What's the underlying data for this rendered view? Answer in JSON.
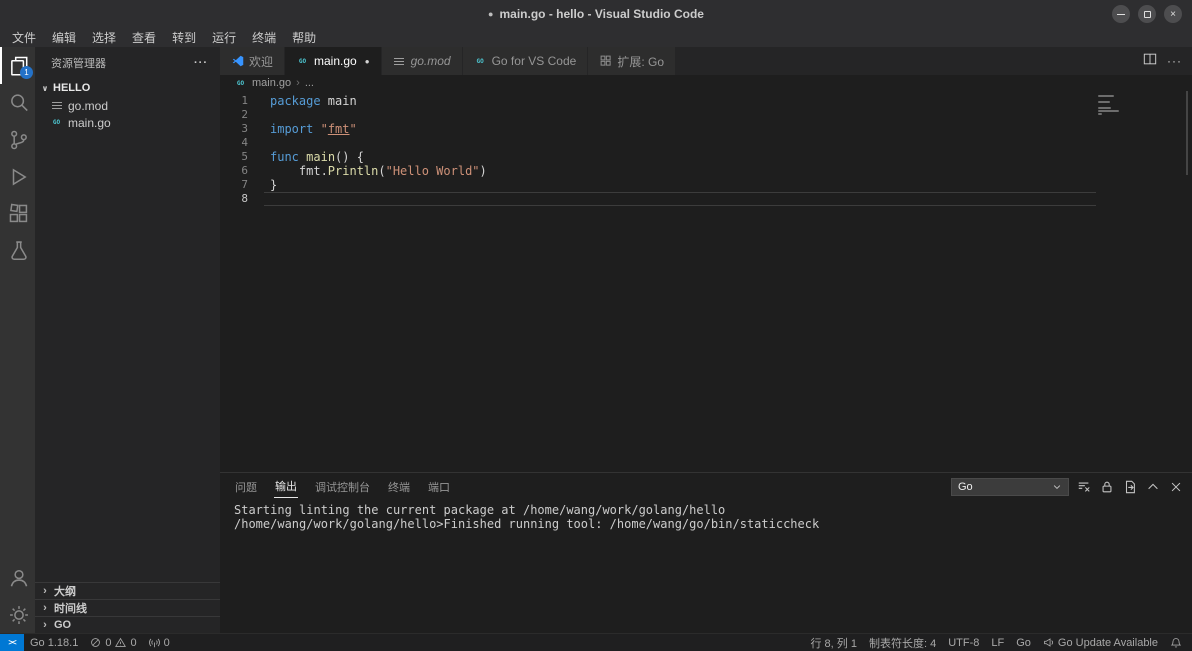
{
  "title_bar": {
    "dirty_dot": "●",
    "title": "main.go - hello - Visual Studio Code"
  },
  "menu_bar": {
    "items": [
      "文件",
      "编辑",
      "选择",
      "查看",
      "转到",
      "运行",
      "终端",
      "帮助"
    ]
  },
  "activity_bar": {
    "explorer_badge": "1"
  },
  "sidebar": {
    "header": "资源管理器",
    "more": "···",
    "folder": "HELLO",
    "files": [
      {
        "name": "go.mod",
        "icon": "gomod"
      },
      {
        "name": "main.go",
        "icon": "go"
      }
    ],
    "sections": [
      "大纲",
      "时间线",
      "GO"
    ]
  },
  "editor_tabs": [
    {
      "label": "欢迎",
      "icon": "vscode",
      "active": false,
      "modified": false,
      "italic": false
    },
    {
      "label": "main.go",
      "icon": "go",
      "active": true,
      "modified": true,
      "italic": false
    },
    {
      "label": "go.mod",
      "icon": "gomod",
      "active": false,
      "modified": false,
      "italic": true
    },
    {
      "label": "Go for VS Code",
      "icon": "go",
      "active": false,
      "modified": false,
      "italic": false
    },
    {
      "label": "扩展: Go",
      "icon": "extensions",
      "active": false,
      "modified": false,
      "italic": false
    }
  ],
  "breadcrumb": {
    "file": "main.go",
    "more": "..."
  },
  "editor": {
    "lines": [
      {
        "num": "1",
        "current": false,
        "tokens": [
          {
            "text": "package",
            "type": "keyword"
          },
          {
            "text": " main",
            "type": "plain"
          }
        ]
      },
      {
        "num": "2",
        "current": false,
        "tokens": []
      },
      {
        "num": "3",
        "current": false,
        "tokens": [
          {
            "text": "import",
            "type": "keyword"
          },
          {
            "text": " ",
            "type": "plain"
          },
          {
            "text": "\"",
            "type": "string"
          },
          {
            "text": "fmt",
            "type": "string-link"
          },
          {
            "text": "\"",
            "type": "string"
          }
        ]
      },
      {
        "num": "4",
        "current": false,
        "tokens": []
      },
      {
        "num": "5",
        "current": false,
        "tokens": [
          {
            "text": "func",
            "type": "keyword"
          },
          {
            "text": " ",
            "type": "plain"
          },
          {
            "text": "main",
            "type": "function"
          },
          {
            "text": "() {",
            "type": "plain"
          }
        ]
      },
      {
        "num": "6",
        "current": false,
        "tokens": [
          {
            "text": "    fmt.",
            "type": "plain"
          },
          {
            "text": "Println",
            "type": "function"
          },
          {
            "text": "(",
            "type": "plain"
          },
          {
            "text": "\"Hello World\"",
            "type": "string"
          },
          {
            "text": ")",
            "type": "plain"
          }
        ]
      },
      {
        "num": "7",
        "current": false,
        "tokens": [
          {
            "text": "}",
            "type": "plain"
          }
        ]
      },
      {
        "num": "8",
        "current": true,
        "tokens": []
      }
    ]
  },
  "panel": {
    "tabs": [
      {
        "label": "问题",
        "active": false
      },
      {
        "label": "输出",
        "active": true
      },
      {
        "label": "调试控制台",
        "active": false
      },
      {
        "label": "终端",
        "active": false
      },
      {
        "label": "端口",
        "active": false
      }
    ],
    "channel": "Go",
    "output_lines": [
      "Starting linting the current package at /home/wang/work/golang/hello",
      "/home/wang/work/golang/hello>Finished running tool: /home/wang/go/bin/staticcheck"
    ]
  },
  "status_bar": {
    "remote_glyph": "><",
    "go_version": "Go 1.18.1",
    "errors": "0",
    "warnings": "0",
    "ports": "0",
    "cursor_position": "行 8, 列 1",
    "tab_size": "制表符长度: 4",
    "encoding": "UTF-8",
    "eol": "LF",
    "language": "Go",
    "update_notice": "Go Update Available"
  },
  "colors": {
    "status_remote_bg": "#0078d4",
    "badge_bg": "#2472c8",
    "keyword": "#569cd6",
    "string": "#ce9178",
    "function": "#dcdcaa",
    "go_icon": "#4ec9d4"
  }
}
